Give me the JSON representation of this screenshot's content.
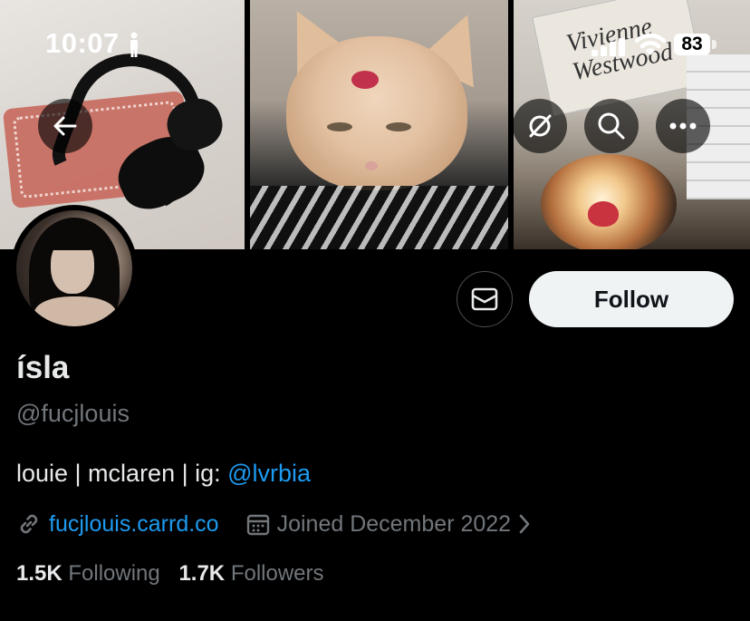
{
  "status_bar": {
    "time": "10:07",
    "battery": "83"
  },
  "banner": {
    "panel3_text": "Vivienne Westwood"
  },
  "actions": {
    "follow_label": "Follow"
  },
  "profile": {
    "display_name": "ísla",
    "handle": "@fucjlouis",
    "bio_text": "louie | mclaren | ig: ",
    "bio_mention": "@lvrbia",
    "website": "fucjlouis.carrd.co",
    "joined": "Joined December 2022"
  },
  "stats": {
    "following_count": "1.5K",
    "following_label": "Following",
    "followers_count": "1.7K",
    "followers_label": "Followers"
  },
  "colors": {
    "accent": "#1d9bf0",
    "secondary_text": "#71767b",
    "primary_text": "#e7e9ea",
    "background": "#000000"
  },
  "icons": [
    "back-arrow-icon",
    "grok-icon",
    "search-icon",
    "more-icon",
    "mail-icon",
    "link-icon",
    "calendar-icon",
    "chevron-right-icon",
    "signal-icon",
    "wifi-icon",
    "person-icon"
  ]
}
